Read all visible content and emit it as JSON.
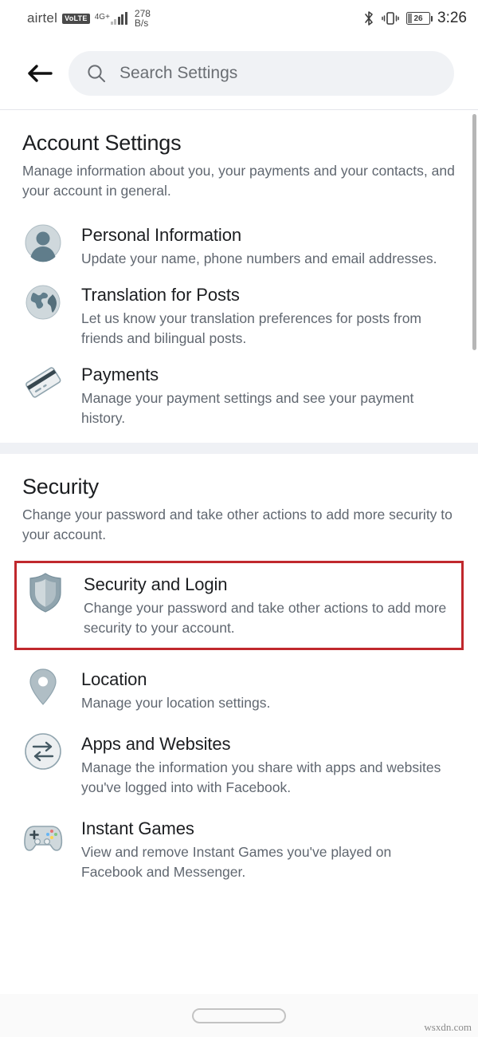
{
  "status_bar": {
    "carrier": "airtel",
    "volte_badge": "VoLTE",
    "network_type": "4G+",
    "data_speed_value": "278",
    "data_speed_unit": "B/s",
    "bluetooth_icon": "bluetooth-icon",
    "vibrate_icon": "vibrate-icon",
    "battery_percent": "26",
    "time": "3:26"
  },
  "header": {
    "back_icon": "back-arrow-icon",
    "search_icon": "search-icon",
    "search_placeholder": "Search Settings",
    "search_value": ""
  },
  "sections": [
    {
      "title": "Account Settings",
      "subtitle": "Manage information about you, your payments and your contacts, and your account in general.",
      "items": [
        {
          "icon": "person-avatar-icon",
          "title": "Personal Information",
          "desc": "Update your name, phone numbers and email addresses.",
          "highlighted": false
        },
        {
          "icon": "globe-icon",
          "title": "Translation for Posts",
          "desc": "Let us know your translation preferences for posts from friends and bilingual posts.",
          "highlighted": false
        },
        {
          "icon": "credit-card-icon",
          "title": "Payments",
          "desc": "Manage your payment settings and see your payment history.",
          "highlighted": false
        }
      ]
    },
    {
      "title": "Security",
      "subtitle": "Change your password and take other actions to add more security to your account.",
      "items": [
        {
          "icon": "shield-icon",
          "title": "Security and Login",
          "desc": "Change your password and take other actions to add more security to your account.",
          "highlighted": true
        },
        {
          "icon": "location-pin-icon",
          "title": "Location",
          "desc": "Manage your location settings.",
          "highlighted": false
        },
        {
          "icon": "exchange-arrows-icon",
          "title": "Apps and Websites",
          "desc": "Manage the information you share with apps and websites you've logged into with Facebook.",
          "highlighted": false
        },
        {
          "icon": "game-controller-icon",
          "title": "Instant Games",
          "desc": "View and remove Instant Games you've played on Facebook and Messenger.",
          "highlighted": false
        }
      ]
    }
  ],
  "bottom_bar": {
    "home_indicator": "home-indicator-pill",
    "watermark": "wsxdn.com"
  },
  "colors": {
    "highlight_red": "#c0282d",
    "icon_light": "#cfd8dc",
    "icon_dark": "#607d8b",
    "text_primary": "#1c1e21",
    "text_secondary": "#606770",
    "search_bg": "#f0f2f5"
  }
}
